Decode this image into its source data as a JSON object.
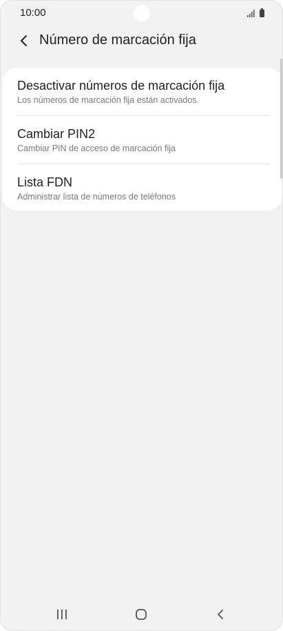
{
  "status_bar": {
    "time": "10:00",
    "icons": [
      "signal-icon",
      "battery-icon"
    ]
  },
  "app_bar": {
    "back_icon": "chevron-left-icon",
    "title": "Número de marcación fija"
  },
  "settings": {
    "items": [
      {
        "title": "Desactivar números de marcación fija",
        "subtitle": "Los números de marcación fija están activados."
      },
      {
        "title": "Cambiar PIN2",
        "subtitle": "Cambiar PIN de acceso de marcación fija"
      },
      {
        "title": "Lista FDN",
        "subtitle": "Administrar lista de números de teléfonos"
      }
    ]
  },
  "nav_bar": {
    "buttons": [
      "recent-apps-icon",
      "home-icon",
      "back-icon"
    ]
  },
  "colors": {
    "background": "#f2f2f2",
    "card": "#ffffff",
    "title_text": "#1f1f1f",
    "subtitle_text": "#7a7a7a"
  }
}
